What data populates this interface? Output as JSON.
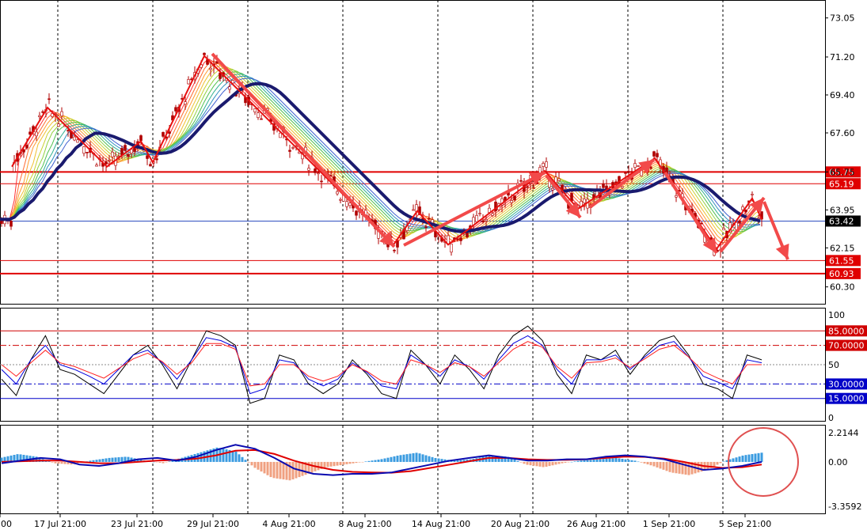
{
  "chart_data": [
    {
      "panel": "price",
      "type": "candlestick",
      "y_axis_ticks": [
        "73.05",
        "71.20",
        "69.40",
        "67.60",
        "65.75",
        "63.95",
        "62.15",
        "60.30"
      ],
      "ylim": [
        59.8,
        73.6
      ],
      "horizontal_levels": [
        {
          "value": 65.75,
          "label": "65.75",
          "color": "#e00000"
        },
        {
          "value": 65.19,
          "label": "65.19",
          "color": "#e00000"
        },
        {
          "value": 61.55,
          "label": "61.55",
          "color": "#e00000"
        },
        {
          "value": 60.93,
          "label": "60.93",
          "color": "#e00000"
        }
      ],
      "current_price": {
        "value": 63.42,
        "label": "63.42"
      },
      "trend_pivots": [
        66.0,
        68.8,
        66.0,
        67.2,
        66.2,
        71.25,
        62.3,
        63.9,
        62.3,
        65.8,
        64.0,
        66.4,
        62.1,
        64.5,
        63.5
      ],
      "moving_average_ribbon": true,
      "colors": {
        "candle": "#b00000",
        "ma_slow": "#1a1a6e",
        "arrows": "#f24a4a",
        "levels": "#e00000",
        "current": "#3050c0"
      }
    },
    {
      "panel": "stochastic",
      "type": "line",
      "y_axis_ticks": [
        "100",
        "50",
        "0"
      ],
      "ylim": [
        0,
        100
      ],
      "levels": [
        {
          "value": 85,
          "label": "85.0000",
          "color": "#d00000",
          "style": "solid"
        },
        {
          "value": 70,
          "label": "70.0000",
          "color": "#d00000",
          "style": "dashdot"
        },
        {
          "value": 30,
          "label": "30.0000",
          "color": "#0000c8",
          "style": "dashdot"
        },
        {
          "value": 15,
          "label": "15.0000",
          "color": "#0000c8",
          "style": "solid"
        }
      ],
      "series": [
        {
          "color": "#000000",
          "values": [
            35,
            18,
            55,
            80,
            45,
            40,
            30,
            20,
            40,
            60,
            70,
            50,
            25,
            55,
            85,
            80,
            70,
            10,
            15,
            60,
            55,
            30,
            20,
            30,
            55,
            40,
            20,
            15,
            65,
            50,
            30,
            60,
            45,
            25,
            60,
            80,
            90,
            75,
            40,
            20,
            60,
            55,
            65,
            40,
            60,
            75,
            80,
            60,
            30,
            25,
            15,
            60,
            55
          ]
        },
        {
          "color": "#0000dd",
          "values": [
            45,
            30,
            55,
            70,
            50,
            45,
            38,
            30,
            45,
            60,
            65,
            52,
            35,
            55,
            78,
            75,
            68,
            20,
            25,
            55,
            52,
            35,
            28,
            35,
            52,
            42,
            28,
            25,
            60,
            50,
            38,
            55,
            48,
            35,
            55,
            72,
            80,
            70,
            45,
            30,
            55,
            55,
            60,
            45,
            58,
            70,
            74,
            58,
            38,
            32,
            25,
            55,
            52
          ]
        },
        {
          "color": "#ff2020",
          "values": [
            50,
            38,
            52,
            65,
            52,
            48,
            42,
            36,
            46,
            56,
            62,
            53,
            40,
            52,
            72,
            72,
            66,
            28,
            30,
            50,
            50,
            38,
            33,
            38,
            50,
            43,
            33,
            30,
            55,
            50,
            42,
            52,
            48,
            38,
            52,
            66,
            74,
            68,
            48,
            36,
            52,
            53,
            57,
            47,
            56,
            66,
            70,
            58,
            43,
            36,
            30,
            50,
            50
          ]
        }
      ]
    },
    {
      "panel": "macd",
      "type": "bar",
      "y_axis_ticks": [
        "2.2144",
        "0.00",
        "-3.3592"
      ],
      "ylim": [
        -3.3592,
        2.2144
      ],
      "histogram": [
        0.3,
        0.6,
        0.4,
        -0.1,
        -0.2,
        0.1,
        0.3,
        0.4,
        0.1,
        -0.1,
        0.3,
        0.7,
        1.1,
        0.8,
        -0.4,
        -1.2,
        -1.4,
        -0.9,
        -0.4,
        -0.2,
        0,
        0.2,
        0.5,
        0.7,
        0.3,
        0.1,
        0.2,
        0.5,
        0.4,
        -0.2,
        -0.4,
        -0.1,
        0.1,
        0.2,
        0.3,
        0.1,
        -0.3,
        -0.8,
        -1.0,
        -0.6,
        0.1,
        0.5,
        0.7
      ],
      "macd_line": [
        -0.1,
        0.1,
        0.3,
        0.2,
        -0.2,
        -0.3,
        -0.1,
        0.2,
        0.3,
        0.1,
        0.4,
        0.9,
        1.3,
        1.0,
        0.3,
        -0.5,
        -0.9,
        -1.0,
        -0.9,
        -0.9,
        -0.8,
        -0.5,
        -0.2,
        0.1,
        0.3,
        0.5,
        0.3,
        0.1,
        0.1,
        0.2,
        0.2,
        0.4,
        0.5,
        0.4,
        0.2,
        -0.2,
        -0.6,
        -0.5,
        -0.3,
        0.0
      ],
      "signal_line": [
        0.0,
        0.05,
        0.1,
        0.1,
        0.0,
        -0.1,
        -0.1,
        0.0,
        0.1,
        0.15,
        0.25,
        0.5,
        0.85,
        0.9,
        0.6,
        0.1,
        -0.3,
        -0.6,
        -0.75,
        -0.8,
        -0.82,
        -0.7,
        -0.45,
        -0.2,
        0.05,
        0.3,
        0.3,
        0.2,
        0.15,
        0.15,
        0.2,
        0.3,
        0.4,
        0.38,
        0.25,
        0.0,
        -0.3,
        -0.45,
        -0.4,
        -0.2
      ],
      "colors": {
        "pos": "#3a9be0",
        "neg": "#f0a080",
        "macd": "#0a0ab0",
        "signal": "#e00000",
        "highlight": "#e05050"
      }
    }
  ],
  "x_axis": {
    "labels": [
      "00",
      "17 Jul 21:00",
      "23 Jul 21:00",
      "29 Jul 21:00",
      "4 Aug 21:00",
      "8 Aug 21:00",
      "14 Aug 21:00",
      "20 Aug 21:00",
      "26 Aug 21:00",
      "1 Sep 21:00",
      "5 Sep 21:00"
    ]
  }
}
